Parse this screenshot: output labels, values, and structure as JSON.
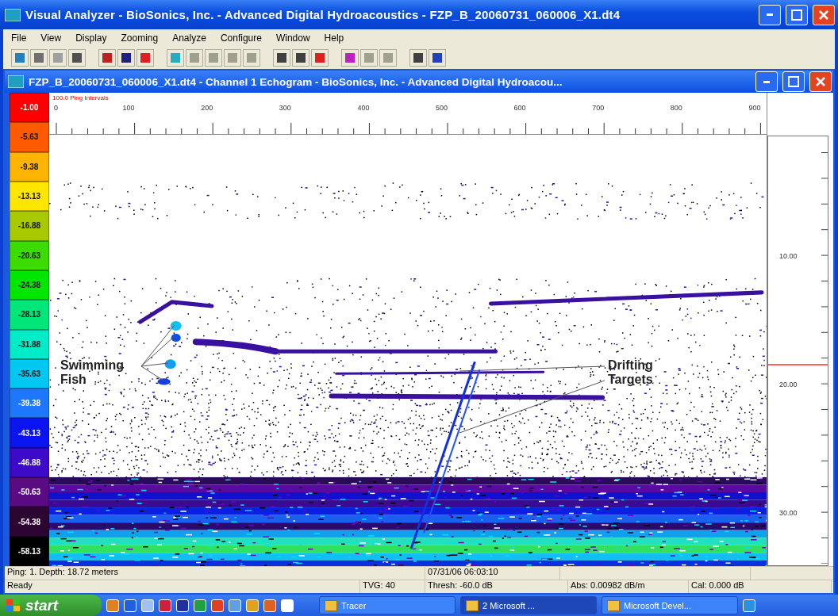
{
  "window": {
    "title": "Visual Analyzer - BioSonics, Inc. - Advanced Digital Hydroacoustics - FZP_B_20060731_060006_X1.dt4"
  },
  "menu": [
    "File",
    "View",
    "Display",
    "Zooming",
    "Analyze",
    "Configure",
    "Window",
    "Help"
  ],
  "child_window": {
    "title": "FZP_B_20060731_060006_X1.dt4 - Channel 1  Echogram - BioSonics, Inc. - Advanced Digital Hydroacou..."
  },
  "color_scale": [
    {
      "label": "-1.00",
      "color": "#ff0000"
    },
    {
      "label": "-5.63",
      "color": "#ff5a00"
    },
    {
      "label": "-9.38",
      "color": "#ffb400"
    },
    {
      "label": "-13.13",
      "color": "#ffe600"
    },
    {
      "label": "-16.88",
      "color": "#a8c800"
    },
    {
      "label": "-20.63",
      "color": "#3cdc00"
    },
    {
      "label": "-24.38",
      "color": "#00e600"
    },
    {
      "label": "-28.13",
      "color": "#00e678"
    },
    {
      "label": "-31.88",
      "color": "#00ecc8"
    },
    {
      "label": "-35.63",
      "color": "#00c8f0"
    },
    {
      "label": "-39.38",
      "color": "#1e78ff"
    },
    {
      "label": "-43.13",
      "color": "#0a14f0"
    },
    {
      "label": "-46.88",
      "color": "#3c0ac8"
    },
    {
      "label": "-50.63",
      "color": "#5a0a82"
    },
    {
      "label": "-54.38",
      "color": "#2d0532"
    },
    {
      "label": "-58.13",
      "color": "#000000"
    }
  ],
  "ruler": {
    "caption": "100.0 Ping Intervals",
    "ticks": [
      "0",
      "100",
      "200",
      "300",
      "400",
      "500",
      "600",
      "700",
      "800",
      "900"
    ]
  },
  "depth_axis": {
    "ticks": [
      "10.00",
      "20.00",
      "30.00"
    ]
  },
  "annotations": [
    {
      "label": "Swimming Fish",
      "kind": "fish"
    },
    {
      "label": "Drifting Targets",
      "kind": "drift"
    }
  ],
  "status_bar": {
    "row_1": [
      "Ping: 1. Depth: 18.72 meters",
      "07/31/06 06:03:10"
    ],
    "row_2": [
      "Ready",
      "TVG: 40",
      "Thresh: -60.0 dB",
      "Abs: 0.00982 dB/m",
      "Cal: 0.000 dB"
    ]
  },
  "taskbar": {
    "start": "start",
    "tasks": [
      {
        "label": "Tracer",
        "selected": false
      },
      {
        "label": "2 Microsoft ...",
        "selected": true
      },
      {
        "label": "Microsoft Devel...",
        "selected": false
      }
    ]
  }
}
